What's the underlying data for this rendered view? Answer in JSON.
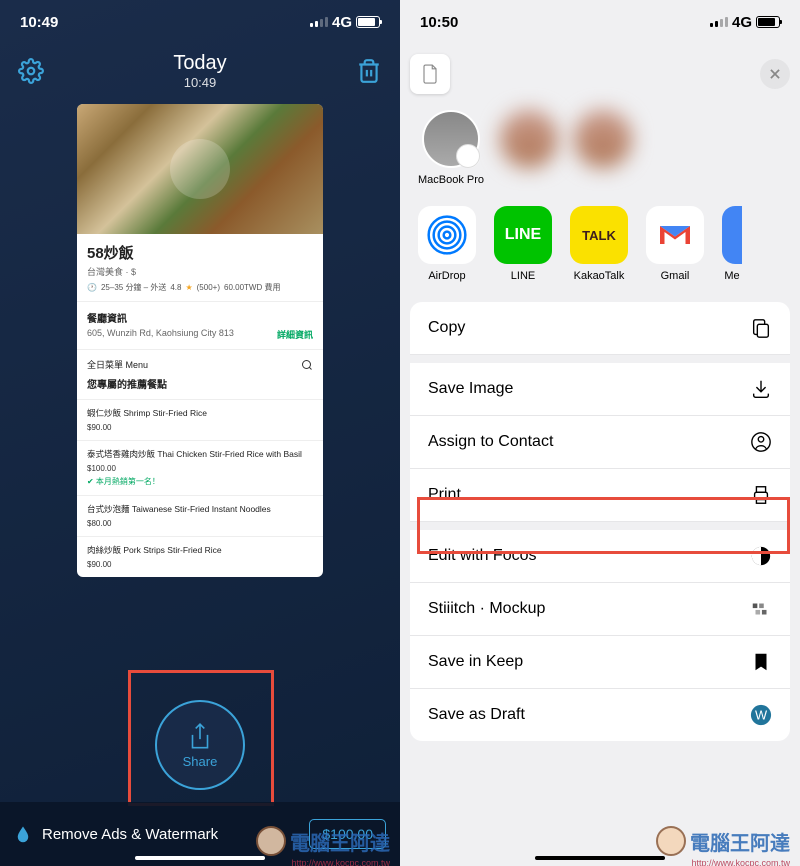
{
  "left": {
    "status_time": "10:49",
    "network": "4G",
    "header": {
      "title": "Today",
      "sub": "10:49"
    },
    "card": {
      "title": "58炒飯",
      "subtitle": "台灣美食 · $",
      "time": "25–35 分鐘 – 外送",
      "rating": "4.8",
      "rating_count": "(500+)",
      "fee": "60.00TWD 費用",
      "info_title": "餐廳資訊",
      "address": "605, Wunzih Rd, Kaohsiung City 813",
      "detail_link": "詳細資訊",
      "menu_label": "全日菜單 Menu",
      "rec_title": "您專屬的推薦餐點",
      "items": [
        {
          "name": "蝦仁炒飯 Shrimp Stir-Fried Rice",
          "price": "$90.00"
        },
        {
          "name": "泰式塔香雞肉炒飯 Thai Chicken Stir-Fried Rice with Basil",
          "price": "$100.00",
          "badge": "✔ 本月熱銷第一名！"
        },
        {
          "name": "台式炒泡麵 Taiwanese Stir-Fried Instant Noodles",
          "price": "$80.00"
        },
        {
          "name": "肉絲炒飯 Pork Strips Stir-Fried Rice",
          "price": "$90.00"
        }
      ]
    },
    "share_label": "Share",
    "ad_text": "Remove Ads & Watermark",
    "price_btn": "$100.00"
  },
  "right": {
    "status_time": "10:50",
    "network": "4G",
    "contacts": [
      {
        "name": "MacBook Pro"
      }
    ],
    "apps": [
      {
        "key": "airdrop",
        "label": "AirDrop"
      },
      {
        "key": "line",
        "label": "LINE"
      },
      {
        "key": "kakao",
        "label": "KakaoTalk"
      },
      {
        "key": "gmail",
        "label": "Gmail"
      },
      {
        "key": "me",
        "label": "Me"
      }
    ],
    "actions": [
      {
        "label": "Copy",
        "icon": "copy"
      },
      {
        "label": "Save Image",
        "icon": "download"
      },
      {
        "label": "Assign to Contact",
        "icon": "contact"
      },
      {
        "label": "Print",
        "icon": "print"
      },
      {
        "label": "Edit with Focos",
        "icon": "focos"
      },
      {
        "label": "Stiiitch · Mockup",
        "icon": "stitch"
      },
      {
        "label": "Save in Keep",
        "icon": "keep"
      },
      {
        "label": "Save as Draft",
        "icon": "draft"
      }
    ]
  },
  "watermark": {
    "text": "電腦王阿達",
    "url": "http://www.kocpc.com.tw"
  }
}
